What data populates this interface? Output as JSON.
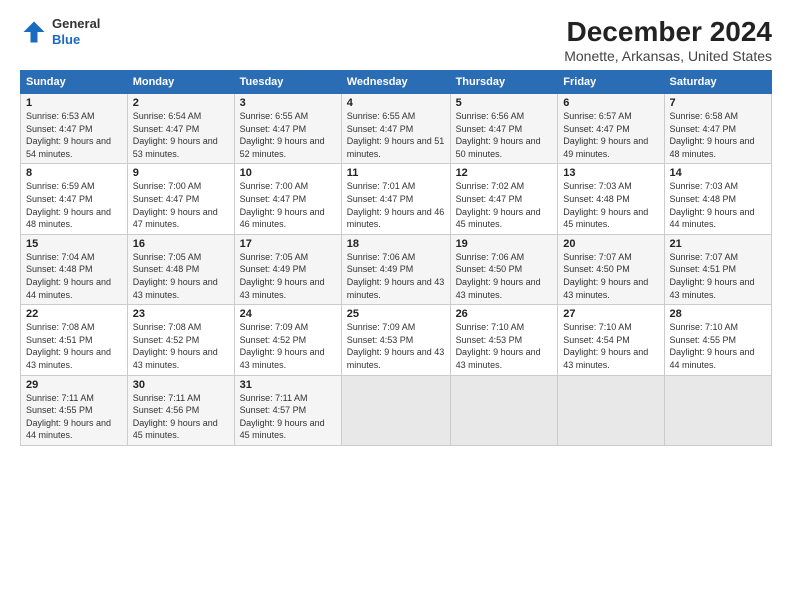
{
  "logo": {
    "general": "General",
    "blue": "Blue"
  },
  "title": "December 2024",
  "subtitle": "Monette, Arkansas, United States",
  "headers": [
    "Sunday",
    "Monday",
    "Tuesday",
    "Wednesday",
    "Thursday",
    "Friday",
    "Saturday"
  ],
  "weeks": [
    [
      {
        "day": "1",
        "sunrise": "6:53 AM",
        "sunset": "4:47 PM",
        "daylight": "9 hours and 54 minutes."
      },
      {
        "day": "2",
        "sunrise": "6:54 AM",
        "sunset": "4:47 PM",
        "daylight": "9 hours and 53 minutes."
      },
      {
        "day": "3",
        "sunrise": "6:55 AM",
        "sunset": "4:47 PM",
        "daylight": "9 hours and 52 minutes."
      },
      {
        "day": "4",
        "sunrise": "6:55 AM",
        "sunset": "4:47 PM",
        "daylight": "9 hours and 51 minutes."
      },
      {
        "day": "5",
        "sunrise": "6:56 AM",
        "sunset": "4:47 PM",
        "daylight": "9 hours and 50 minutes."
      },
      {
        "day": "6",
        "sunrise": "6:57 AM",
        "sunset": "4:47 PM",
        "daylight": "9 hours and 49 minutes."
      },
      {
        "day": "7",
        "sunrise": "6:58 AM",
        "sunset": "4:47 PM",
        "daylight": "9 hours and 48 minutes."
      }
    ],
    [
      {
        "day": "8",
        "sunrise": "6:59 AM",
        "sunset": "4:47 PM",
        "daylight": "9 hours and 48 minutes."
      },
      {
        "day": "9",
        "sunrise": "7:00 AM",
        "sunset": "4:47 PM",
        "daylight": "9 hours and 47 minutes."
      },
      {
        "day": "10",
        "sunrise": "7:00 AM",
        "sunset": "4:47 PM",
        "daylight": "9 hours and 46 minutes."
      },
      {
        "day": "11",
        "sunrise": "7:01 AM",
        "sunset": "4:47 PM",
        "daylight": "9 hours and 46 minutes."
      },
      {
        "day": "12",
        "sunrise": "7:02 AM",
        "sunset": "4:47 PM",
        "daylight": "9 hours and 45 minutes."
      },
      {
        "day": "13",
        "sunrise": "7:03 AM",
        "sunset": "4:48 PM",
        "daylight": "9 hours and 45 minutes."
      },
      {
        "day": "14",
        "sunrise": "7:03 AM",
        "sunset": "4:48 PM",
        "daylight": "9 hours and 44 minutes."
      }
    ],
    [
      {
        "day": "15",
        "sunrise": "7:04 AM",
        "sunset": "4:48 PM",
        "daylight": "9 hours and 44 minutes."
      },
      {
        "day": "16",
        "sunrise": "7:05 AM",
        "sunset": "4:48 PM",
        "daylight": "9 hours and 43 minutes."
      },
      {
        "day": "17",
        "sunrise": "7:05 AM",
        "sunset": "4:49 PM",
        "daylight": "9 hours and 43 minutes."
      },
      {
        "day": "18",
        "sunrise": "7:06 AM",
        "sunset": "4:49 PM",
        "daylight": "9 hours and 43 minutes."
      },
      {
        "day": "19",
        "sunrise": "7:06 AM",
        "sunset": "4:50 PM",
        "daylight": "9 hours and 43 minutes."
      },
      {
        "day": "20",
        "sunrise": "7:07 AM",
        "sunset": "4:50 PM",
        "daylight": "9 hours and 43 minutes."
      },
      {
        "day": "21",
        "sunrise": "7:07 AM",
        "sunset": "4:51 PM",
        "daylight": "9 hours and 43 minutes."
      }
    ],
    [
      {
        "day": "22",
        "sunrise": "7:08 AM",
        "sunset": "4:51 PM",
        "daylight": "9 hours and 43 minutes."
      },
      {
        "day": "23",
        "sunrise": "7:08 AM",
        "sunset": "4:52 PM",
        "daylight": "9 hours and 43 minutes."
      },
      {
        "day": "24",
        "sunrise": "7:09 AM",
        "sunset": "4:52 PM",
        "daylight": "9 hours and 43 minutes."
      },
      {
        "day": "25",
        "sunrise": "7:09 AM",
        "sunset": "4:53 PM",
        "daylight": "9 hours and 43 minutes."
      },
      {
        "day": "26",
        "sunrise": "7:10 AM",
        "sunset": "4:53 PM",
        "daylight": "9 hours and 43 minutes."
      },
      {
        "day": "27",
        "sunrise": "7:10 AM",
        "sunset": "4:54 PM",
        "daylight": "9 hours and 43 minutes."
      },
      {
        "day": "28",
        "sunrise": "7:10 AM",
        "sunset": "4:55 PM",
        "daylight": "9 hours and 44 minutes."
      }
    ],
    [
      {
        "day": "29",
        "sunrise": "7:11 AM",
        "sunset": "4:55 PM",
        "daylight": "9 hours and 44 minutes."
      },
      {
        "day": "30",
        "sunrise": "7:11 AM",
        "sunset": "4:56 PM",
        "daylight": "9 hours and 45 minutes."
      },
      {
        "day": "31",
        "sunrise": "7:11 AM",
        "sunset": "4:57 PM",
        "daylight": "9 hours and 45 minutes."
      },
      null,
      null,
      null,
      null
    ]
  ],
  "labels": {
    "sunrise": "Sunrise:",
    "sunset": "Sunset:",
    "daylight": "Daylight:"
  }
}
